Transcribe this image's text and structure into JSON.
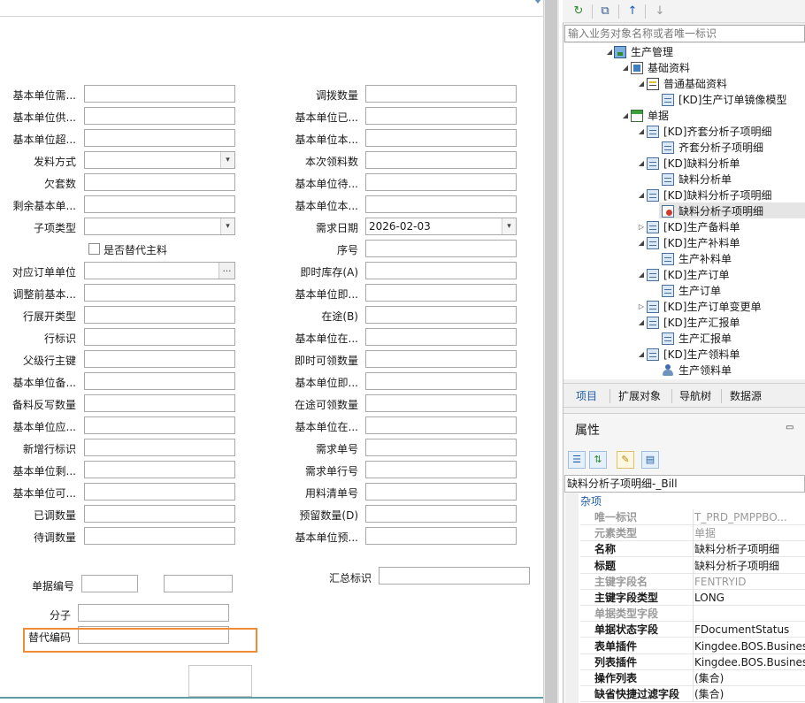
{
  "form": {
    "fields_left": [
      {
        "label": "基本单位需...",
        "type": "text"
      },
      {
        "label": "基本单位供...",
        "type": "text"
      },
      {
        "label": "基本单位超...",
        "type": "text"
      },
      {
        "label": "发料方式",
        "type": "combo"
      },
      {
        "label": "欠套数",
        "type": "text"
      },
      {
        "label": "剩余基本单...",
        "type": "text"
      },
      {
        "label": "子项类型",
        "type": "combo"
      },
      {
        "label": "对应订单单位",
        "type": "lookup"
      },
      {
        "label": "调整前基本...",
        "type": "text"
      },
      {
        "label": "行展开类型",
        "type": "text"
      },
      {
        "label": "行标识",
        "type": "text"
      },
      {
        "label": "父级行主键",
        "type": "text"
      },
      {
        "label": "基本单位备...",
        "type": "text"
      },
      {
        "label": "备料反写数量",
        "type": "text"
      },
      {
        "label": "基本单位应...",
        "type": "text"
      },
      {
        "label": "新增行标识",
        "type": "text"
      },
      {
        "label": "基本单位剩...",
        "type": "text"
      },
      {
        "label": "基本单位可...",
        "type": "text"
      },
      {
        "label": "已调数量",
        "type": "text"
      },
      {
        "label": "待调数量",
        "type": "text"
      }
    ],
    "fields_right": [
      {
        "label": "调拨数量",
        "type": "text"
      },
      {
        "label": "基本单位已...",
        "type": "text"
      },
      {
        "label": "基本单位本...",
        "type": "text"
      },
      {
        "label": "本次领料数",
        "type": "text"
      },
      {
        "label": "基本单位待...",
        "type": "text"
      },
      {
        "label": "基本单位本...",
        "type": "text"
      },
      {
        "label": "需求日期",
        "type": "combo",
        "value": "2026-02-03"
      },
      {
        "label": "序号",
        "type": "text"
      },
      {
        "label": "即时库存(A)",
        "type": "text"
      },
      {
        "label": "基本单位即...",
        "type": "text"
      },
      {
        "label": "在途(B)",
        "type": "text"
      },
      {
        "label": "基本单位在...",
        "type": "text"
      },
      {
        "label": "即时可领数量",
        "type": "text"
      },
      {
        "label": "基本单位即...",
        "type": "text"
      },
      {
        "label": "在途可领数量",
        "type": "text"
      },
      {
        "label": "基本单位在...",
        "type": "text"
      },
      {
        "label": "需求单号",
        "type": "text"
      },
      {
        "label": "需求单行号",
        "type": "text"
      },
      {
        "label": "用料清单号",
        "type": "text"
      },
      {
        "label": "预留数量(D)",
        "type": "text"
      },
      {
        "label": "基本单位预...",
        "type": "text"
      }
    ],
    "checkbox_label": "是否替代主料",
    "bill_no_label": "单据编号",
    "summary_flag_label": "汇总标识",
    "numerator_label": "分子",
    "substitute_code_label": "替代编码",
    "ellipsis": "…",
    "combo_arrow": "▾"
  },
  "right_panel": {
    "toolbar": {
      "refresh_icon": "↻",
      "copy_icon": "⧉",
      "up_icon": "↑",
      "down_icon": "↓"
    },
    "search_placeholder": "输入业务对象名称或者唯一标识",
    "tree": [
      {
        "label": "生产管理",
        "level": 0,
        "icon": "pc",
        "arrow": "◢"
      },
      {
        "label": "基础资料",
        "level": 1,
        "icon": "base",
        "arrow": "◢"
      },
      {
        "label": "普通基础资料",
        "level": 2,
        "icon": "note",
        "arrow": "◢"
      },
      {
        "label": "[KD]生产订单镜像模型",
        "level": 3,
        "icon": "doc",
        "arrow": ""
      },
      {
        "label": "单据",
        "level": 1,
        "icon": "folder",
        "arrow": "◢"
      },
      {
        "label": "[KD]齐套分析子项明细",
        "level": 2,
        "icon": "doc",
        "arrow": "◢"
      },
      {
        "label": "齐套分析子项明细",
        "level": 3,
        "icon": "doc",
        "arrow": ""
      },
      {
        "label": "[KD]缺料分析单",
        "level": 2,
        "icon": "doc",
        "arrow": "◢"
      },
      {
        "label": "缺料分析单",
        "level": 3,
        "icon": "doc",
        "arrow": ""
      },
      {
        "label": "[KD]缺料分析子项明细",
        "level": 2,
        "icon": "doc",
        "arrow": "◢"
      },
      {
        "label": "缺料分析子项明细",
        "level": 3,
        "icon": "red",
        "arrow": "",
        "selected": true
      },
      {
        "label": "[KD]生产备料单",
        "level": 2,
        "icon": "doc",
        "arrow": "▷"
      },
      {
        "label": "[KD]生产补料单",
        "level": 2,
        "icon": "doc",
        "arrow": "◢"
      },
      {
        "label": "生产补料单",
        "level": 3,
        "icon": "doc",
        "arrow": ""
      },
      {
        "label": "[KD]生产订单",
        "level": 2,
        "icon": "doc",
        "arrow": "◢"
      },
      {
        "label": "生产订单",
        "level": 3,
        "icon": "doc",
        "arrow": ""
      },
      {
        "label": "[KD]生产订单变更单",
        "level": 2,
        "icon": "doc",
        "arrow": "▷"
      },
      {
        "label": "[KD]生产汇报单",
        "level": 2,
        "icon": "doc",
        "arrow": "◢"
      },
      {
        "label": "生产汇报单",
        "level": 3,
        "icon": "doc",
        "arrow": ""
      },
      {
        "label": "[KD]生产领料单",
        "level": 2,
        "icon": "doc",
        "arrow": "◢"
      },
      {
        "label": "生产领料单",
        "level": 3,
        "icon": "person",
        "arrow": ""
      }
    ],
    "tabs": [
      "项目",
      "扩展对象",
      "导航树",
      "数据源"
    ],
    "properties": {
      "title": "属性",
      "pin_icon": "▭",
      "toolbar_icons": {
        "categorized": "☰",
        "sort": "⇅",
        "edit": "✎",
        "page": "▤"
      },
      "object_label": "缺料分析子项明细-_Bill",
      "category": "杂项",
      "rows": [
        {
          "name": "唯一标识",
          "value": "T_PRD_PMPPBO...",
          "dim": true
        },
        {
          "name": "元素类型",
          "value": "单据",
          "dim": true
        },
        {
          "name": "名称",
          "value": "缺料分析子项明细",
          "dim": false
        },
        {
          "name": "标题",
          "value": "缺料分析子项明细",
          "dim": false
        },
        {
          "name": "主键字段名",
          "value": "FENTRYID",
          "dim": true
        },
        {
          "name": "主键字段类型",
          "value": "LONG",
          "dim": false
        },
        {
          "name": "单据类型字段",
          "value": "",
          "dim": true
        },
        {
          "name": "单据状态字段",
          "value": "FDocumentStatus",
          "dim": false
        },
        {
          "name": "表单插件",
          "value": "Kingdee.BOS.Business.",
          "dim": false
        },
        {
          "name": "列表插件",
          "value": "Kingdee.BOS.Business.",
          "dim": false
        },
        {
          "name": "操作列表",
          "value": "(集合)",
          "dim": false
        },
        {
          "name": "缺省快捷过滤字段",
          "value": "(集合)",
          "dim": false
        }
      ]
    }
  },
  "colors": {
    "highlight": "#f08c33",
    "accent": "#1d5ca8"
  }
}
